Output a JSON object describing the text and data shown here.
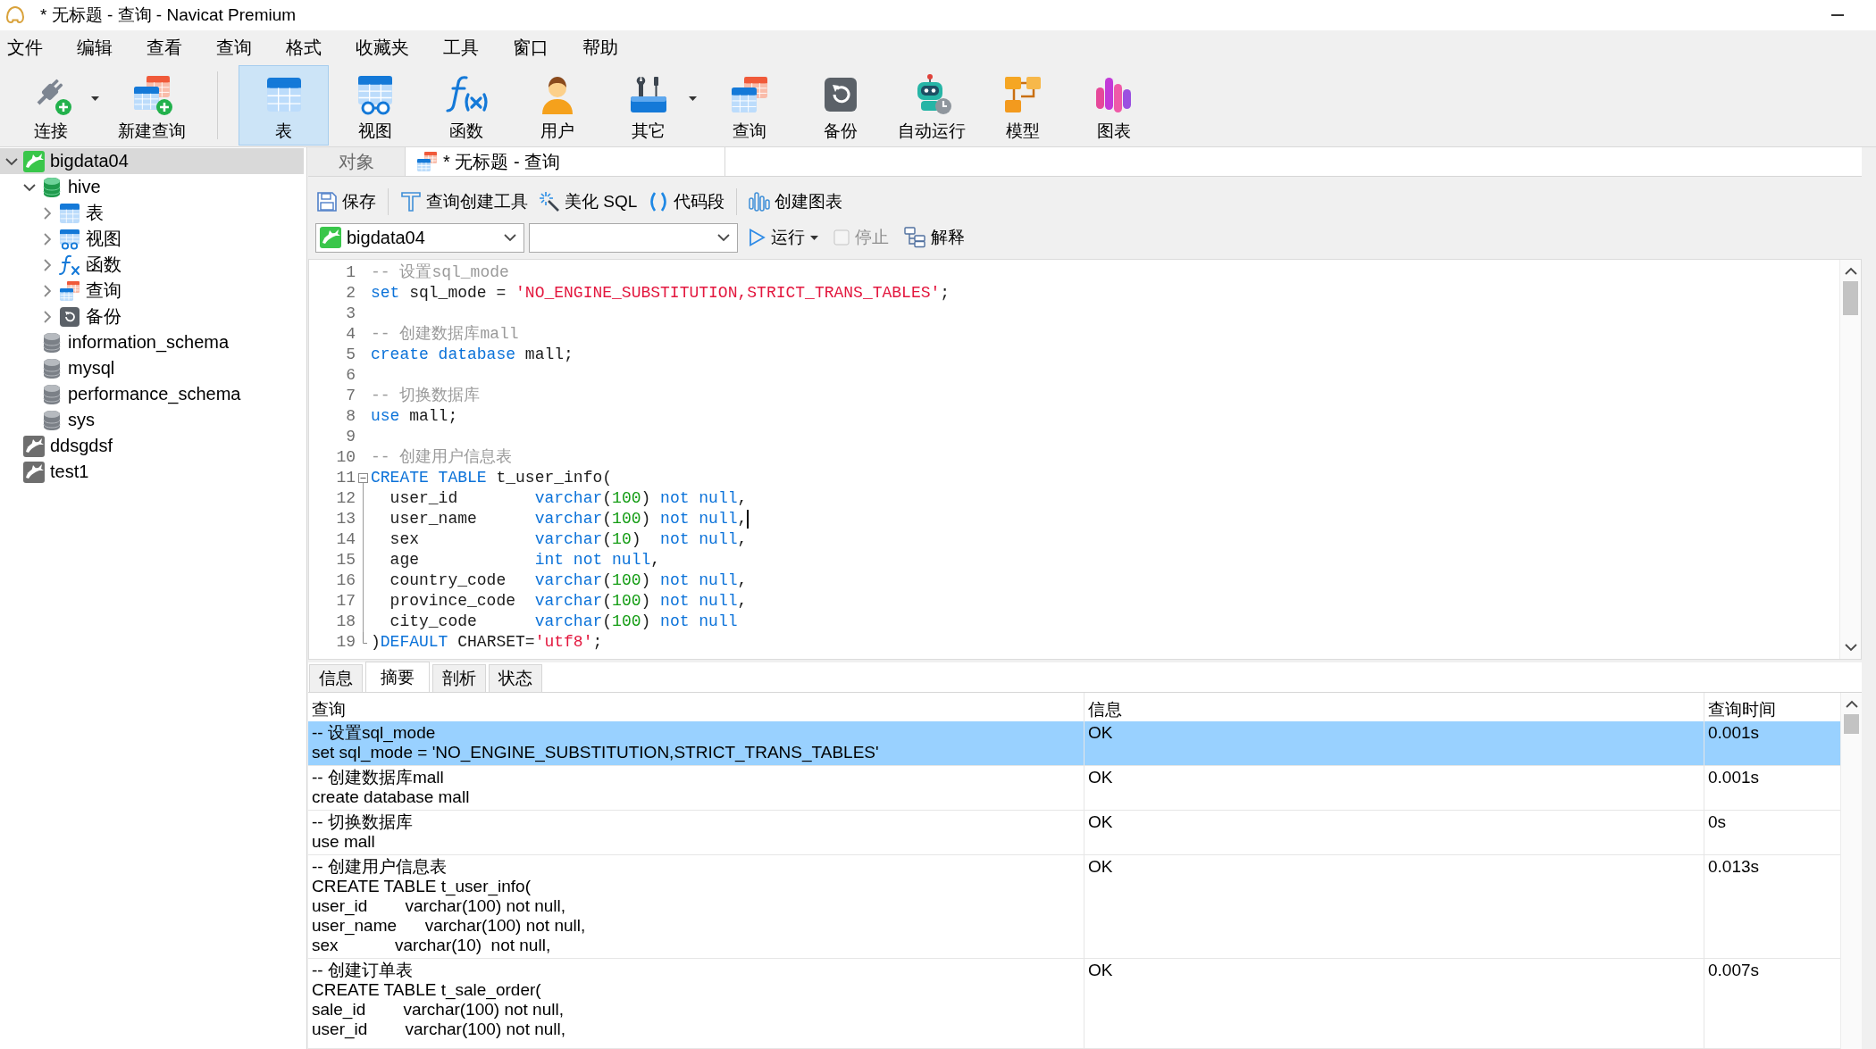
{
  "window": {
    "title": "* 无标题 - 查询 - Navicat Premium"
  },
  "menu": [
    "文件",
    "编辑",
    "查看",
    "查询",
    "格式",
    "收藏夹",
    "工具",
    "窗口",
    "帮助"
  ],
  "toolbar": {
    "groups": [
      {
        "items": [
          {
            "label": "连接",
            "kind": "connect",
            "selected": false,
            "dropdown": true
          },
          {
            "label": "新建查询",
            "kind": "new_query",
            "selected": false,
            "dropdown": false
          }
        ]
      },
      {
        "items": [
          {
            "label": "表",
            "kind": "table",
            "selected": true,
            "dropdown": false
          },
          {
            "label": "视图",
            "kind": "view",
            "selected": false,
            "dropdown": false
          },
          {
            "label": "函数",
            "kind": "function",
            "selected": false,
            "dropdown": false
          },
          {
            "label": "用户",
            "kind": "user",
            "selected": false,
            "dropdown": false
          },
          {
            "label": "其它",
            "kind": "other",
            "selected": false,
            "dropdown": true
          },
          {
            "label": "查询",
            "kind": "query",
            "selected": false,
            "dropdown": false
          },
          {
            "label": "备份",
            "kind": "backup",
            "selected": false,
            "dropdown": false
          },
          {
            "label": "自动运行",
            "kind": "autorun",
            "selected": false,
            "dropdown": false
          },
          {
            "label": "模型",
            "kind": "model",
            "selected": false,
            "dropdown": false
          },
          {
            "label": "图表",
            "kind": "chart",
            "selected": false,
            "dropdown": false
          }
        ]
      }
    ]
  },
  "sidebar": {
    "tree": [
      {
        "label": "bigdata04",
        "kind": "connection",
        "open": true,
        "expanded": true,
        "selected": true,
        "children": [
          {
            "label": "hive",
            "kind": "database",
            "open": true,
            "expanded": true,
            "selected": false,
            "children": [
              {
                "label": "表",
                "kind": "tables",
                "expanded": false,
                "selected": false
              },
              {
                "label": "视图",
                "kind": "views",
                "expanded": false,
                "selected": false
              },
              {
                "label": "函数",
                "kind": "functions",
                "expanded": false,
                "selected": false
              },
              {
                "label": "查询",
                "kind": "queries",
                "expanded": false,
                "selected": false
              },
              {
                "label": "备份",
                "kind": "backups",
                "expanded": false,
                "selected": false
              }
            ]
          },
          {
            "label": "information_schema",
            "kind": "database",
            "open": false,
            "selected": false
          },
          {
            "label": "mysql",
            "kind": "database",
            "open": false,
            "selected": false
          },
          {
            "label": "performance_schema",
            "kind": "database",
            "open": false,
            "selected": false
          },
          {
            "label": "sys",
            "kind": "database",
            "open": false,
            "selected": false
          }
        ]
      },
      {
        "label": "ddsgdsf",
        "kind": "connection",
        "open": false,
        "selected": false
      },
      {
        "label": "test1",
        "kind": "connection",
        "open": false,
        "selected": false
      }
    ]
  },
  "editor_tabs": [
    {
      "label": "对象",
      "kind": "objects",
      "selected": false
    },
    {
      "label": "* 无标题 - 查询",
      "kind": "query",
      "selected": true
    }
  ],
  "query_toolbar": {
    "groups": [
      {
        "items": [
          {
            "label": "保存",
            "kind": "save"
          }
        ]
      },
      {
        "items": [
          {
            "label": "查询创建工具",
            "kind": "builder"
          },
          {
            "label": "美化 SQL",
            "kind": "beautify"
          },
          {
            "label": "代码段",
            "kind": "snippet"
          }
        ]
      },
      {
        "items": [
          {
            "label": "创建图表",
            "kind": "chart"
          }
        ]
      }
    ]
  },
  "run_bar": {
    "selects": [
      {
        "kind": "connection",
        "value": "bigdata04"
      },
      {
        "kind": "database"
      }
    ],
    "run": {
      "label": "运行",
      "dropdown": true
    },
    "stop": {
      "label": "停止",
      "disabled": true
    },
    "explain": {
      "label": "解释"
    }
  },
  "editor": {
    "lines": [
      {
        "number": "1",
        "tokens": [
          {
            "kind": "comment",
            "text": "-- 设置sql_mode"
          }
        ],
        "cursor": false
      },
      {
        "number": "2",
        "tokens": [
          {
            "kind": "keyword",
            "text": "set"
          },
          {
            "kind": "plain",
            "text": " sql_mode = "
          },
          {
            "kind": "string",
            "text": "'NO_ENGINE_SUBSTITUTION,STRICT_TRANS_TABLES'"
          },
          {
            "kind": "plain",
            "text": ";"
          }
        ],
        "cursor": false
      },
      {
        "number": "3",
        "cursor": false
      },
      {
        "number": "4",
        "tokens": [
          {
            "kind": "comment",
            "text": "-- 创建数据库mall"
          }
        ],
        "cursor": false
      },
      {
        "number": "5",
        "tokens": [
          {
            "kind": "keyword",
            "text": "create database"
          },
          {
            "kind": "plain",
            "text": " mall;"
          }
        ],
        "cursor": false
      },
      {
        "number": "6",
        "cursor": false
      },
      {
        "number": "7",
        "tokens": [
          {
            "kind": "comment",
            "text": "-- 切换数据库"
          }
        ],
        "cursor": false
      },
      {
        "number": "8",
        "tokens": [
          {
            "kind": "keyword",
            "text": "use"
          },
          {
            "kind": "plain",
            "text": " mall;"
          }
        ],
        "cursor": false
      },
      {
        "number": "9",
        "cursor": false
      },
      {
        "number": "10",
        "tokens": [
          {
            "kind": "comment",
            "text": "-- 创建用户信息表"
          }
        ],
        "cursor": false
      },
      {
        "number": "11",
        "tokens": [
          {
            "kind": "keyword",
            "text": "CREATE TABLE"
          },
          {
            "kind": "plain",
            "text": " t_user_info("
          }
        ],
        "cursor": false,
        "expanded": true,
        "children": [
          {
            "number": "12",
            "tokens": [
              {
                "kind": "plain",
                "text": "  user_id        "
              },
              {
                "kind": "keyword",
                "text": "varchar"
              },
              {
                "kind": "plain",
                "text": "("
              },
              {
                "kind": "number",
                "text": "100"
              },
              {
                "kind": "plain",
                "text": ") "
              },
              {
                "kind": "keyword",
                "text": "not null"
              },
              {
                "kind": "plain",
                "text": ","
              }
            ],
            "cursor": false
          },
          {
            "number": "13",
            "tokens": [
              {
                "kind": "plain",
                "text": "  user_name      "
              },
              {
                "kind": "keyword",
                "text": "varchar"
              },
              {
                "kind": "plain",
                "text": "("
              },
              {
                "kind": "number",
                "text": "100"
              },
              {
                "kind": "plain",
                "text": ") "
              },
              {
                "kind": "keyword",
                "text": "not null"
              },
              {
                "kind": "plain",
                "text": ","
              }
            ],
            "cursor": true
          },
          {
            "number": "14",
            "tokens": [
              {
                "kind": "plain",
                "text": "  sex            "
              },
              {
                "kind": "keyword",
                "text": "varchar"
              },
              {
                "kind": "plain",
                "text": "("
              },
              {
                "kind": "number",
                "text": "10"
              },
              {
                "kind": "plain",
                "text": ")  "
              },
              {
                "kind": "keyword",
                "text": "not null"
              },
              {
                "kind": "plain",
                "text": ","
              }
            ],
            "cursor": false
          },
          {
            "number": "15",
            "tokens": [
              {
                "kind": "plain",
                "text": "  age            "
              },
              {
                "kind": "keyword",
                "text": "int not null"
              },
              {
                "kind": "plain",
                "text": ","
              }
            ],
            "cursor": false
          },
          {
            "number": "16",
            "tokens": [
              {
                "kind": "plain",
                "text": "  country_code   "
              },
              {
                "kind": "keyword",
                "text": "varchar"
              },
              {
                "kind": "plain",
                "text": "("
              },
              {
                "kind": "number",
                "text": "100"
              },
              {
                "kind": "plain",
                "text": ") "
              },
              {
                "kind": "keyword",
                "text": "not null"
              },
              {
                "kind": "plain",
                "text": ","
              }
            ],
            "cursor": false
          },
          {
            "number": "17",
            "tokens": [
              {
                "kind": "plain",
                "text": "  province_code  "
              },
              {
                "kind": "keyword",
                "text": "varchar"
              },
              {
                "kind": "plain",
                "text": "("
              },
              {
                "kind": "number",
                "text": "100"
              },
              {
                "kind": "plain",
                "text": ") "
              },
              {
                "kind": "keyword",
                "text": "not null"
              },
              {
                "kind": "plain",
                "text": ","
              }
            ],
            "cursor": false
          },
          {
            "number": "18",
            "tokens": [
              {
                "kind": "plain",
                "text": "  city_code      "
              },
              {
                "kind": "keyword",
                "text": "varchar"
              },
              {
                "kind": "plain",
                "text": "("
              },
              {
                "kind": "number",
                "text": "100"
              },
              {
                "kind": "plain",
                "text": ") "
              },
              {
                "kind": "keyword",
                "text": "not null"
              }
            ],
            "cursor": false
          },
          {
            "number": "19",
            "tokens": [
              {
                "kind": "plain",
                "text": ")"
              },
              {
                "kind": "keyword",
                "text": "DEFAULT"
              },
              {
                "kind": "plain",
                "text": " CHARSET="
              },
              {
                "kind": "string",
                "text": "'utf8'"
              },
              {
                "kind": "plain",
                "text": ";"
              }
            ],
            "cursor": false
          }
        ]
      }
    ]
  },
  "results": {
    "tabs": [
      {
        "label": "信息",
        "selected": false
      },
      {
        "label": "摘要",
        "selected": true
      },
      {
        "label": "剖析",
        "selected": false
      },
      {
        "label": "状态",
        "selected": false
      }
    ],
    "columns": [
      "查询",
      "信息",
      "查询时间"
    ],
    "rows": [
      {
        "query": [
          "-- 设置sql_mode",
          "set sql_mode = 'NO_ENGINE_SUBSTITUTION,STRICT_TRANS_TABLES'"
        ],
        "message": "OK",
        "time": "0.001s",
        "selected": true
      },
      {
        "query": [
          "-- 创建数据库mall",
          "create database mall"
        ],
        "message": "OK",
        "time": "0.001s",
        "selected": false
      },
      {
        "query": [
          "-- 切换数据库",
          "use mall"
        ],
        "message": "OK",
        "time": "0s",
        "selected": false
      },
      {
        "query": [
          "-- 创建用户信息表",
          "CREATE TABLE t_user_info(",
          "user_id        varchar(100) not null,",
          "user_name      varchar(100) not null,",
          "sex            varchar(10)  not null,"
        ],
        "message": "OK",
        "time": "0.013s",
        "selected": false
      },
      {
        "query": [
          "-- 创建订单表",
          "CREATE TABLE t_sale_order(",
          "sale_id        varchar(100) not null,",
          "user_id        varchar(100) not null,"
        ],
        "message": "OK",
        "time": "0.007s",
        "selected": false
      }
    ]
  }
}
